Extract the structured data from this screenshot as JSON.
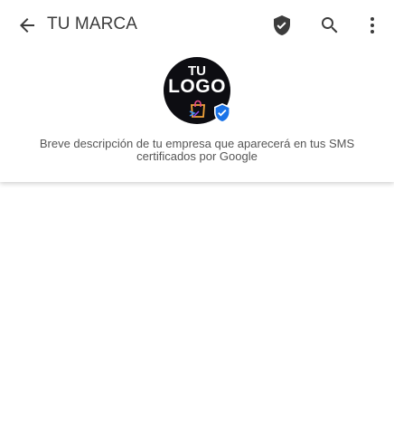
{
  "app": {
    "title": "TU MARCA",
    "colors": {
      "accent": "#1a73e8",
      "icon": "#3c3c3c",
      "logo_background": "#0d0d12"
    }
  },
  "toolbar": {
    "icons": [
      "back-arrow-icon",
      "verified-shield-icon",
      "search-icon",
      "more-vert-icon"
    ]
  },
  "profile": {
    "logo_line1": "TU",
    "logo_line2": "LOGO",
    "description": "Breve descripción de tu empresa que aparecerá en tus SMS certificados por Google"
  }
}
